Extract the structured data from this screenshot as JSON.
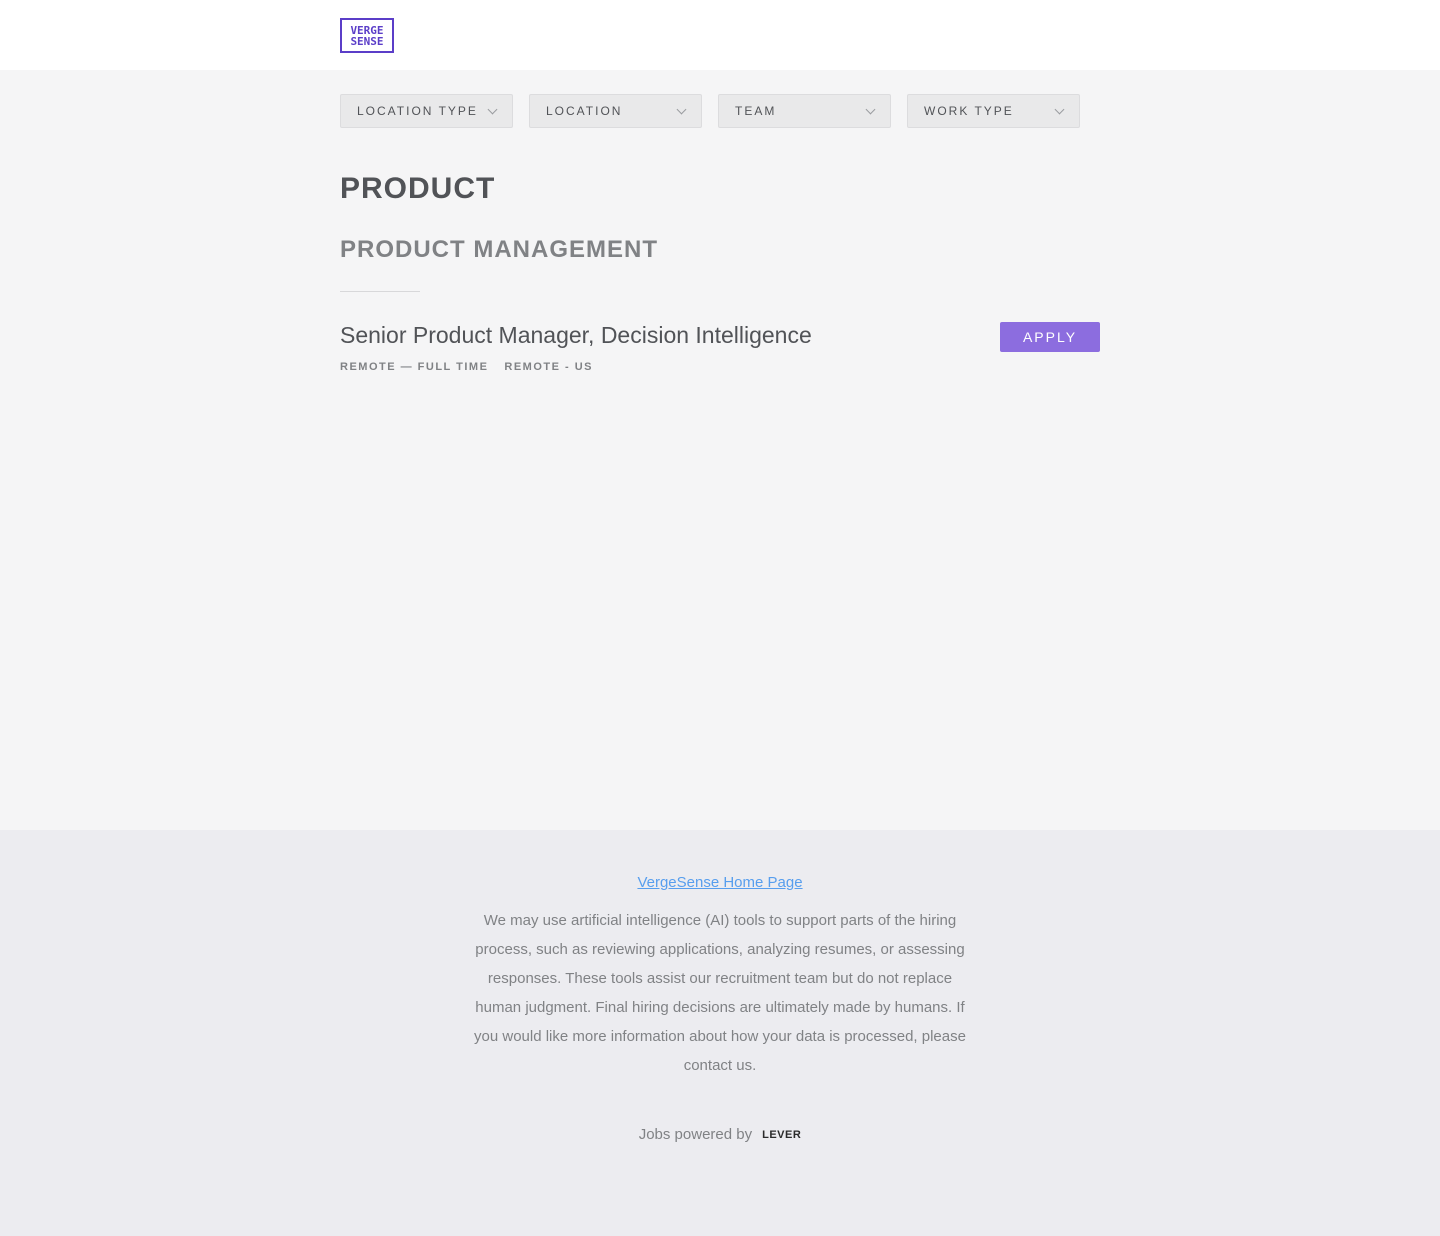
{
  "header": {
    "logo_line1": "VERGE",
    "logo_line2": "SENSE"
  },
  "filters": [
    {
      "label": "LOCATION TYPE"
    },
    {
      "label": "LOCATION"
    },
    {
      "label": "TEAM"
    },
    {
      "label": "WORK TYPE"
    }
  ],
  "group": {
    "title": "PRODUCT",
    "subtitle": "PRODUCT MANAGEMENT"
  },
  "posting": {
    "title": "Senior Product Manager, Decision Intelligence",
    "commitment": "REMOTE — FULL TIME",
    "location": "REMOTE - US",
    "apply_label": "APPLY"
  },
  "footer": {
    "home_link": "VergeSense Home Page",
    "disclaimer": "We may use artificial intelligence (AI) tools to support parts of the hiring process, such as reviewing applications, analyzing resumes, or assessing responses. These tools assist our recruitment team but do not replace human judgment. Final hiring decisions are ultimately made by humans. If you would like more information about how your data is processed, please contact us.",
    "powered_by": "Jobs powered by",
    "lever_logo": "LEVER"
  },
  "colors": {
    "brand": "#5b3ec8",
    "apply_button": "#8c6ddf",
    "link": "#579eee"
  }
}
